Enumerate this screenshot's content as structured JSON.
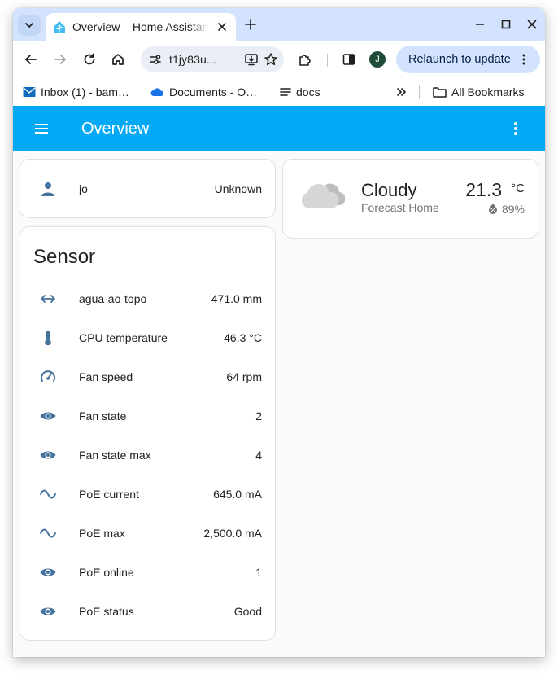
{
  "browser": {
    "tab_title": "Overview – Home Assistant",
    "url": "t1jy83u...",
    "relaunch_label": "Relaunch to update",
    "profile_initial": "J",
    "bookmarks": [
      {
        "label": "Inbox (1) - bam…",
        "icon": "mail-icon"
      },
      {
        "label": "Documents - O…",
        "icon": "onedrive-cloud-icon"
      },
      {
        "label": "docs",
        "icon": "lines-icon"
      }
    ],
    "all_bookmarks_label": "All Bookmarks"
  },
  "app": {
    "title": "Overview",
    "header_color": "#03a9f4"
  },
  "person": {
    "name": "jo",
    "state": "Unknown"
  },
  "weather": {
    "condition": "Cloudy",
    "location": "Forecast Home",
    "temperature": "21.3",
    "unit": "°C",
    "humidity": "89%"
  },
  "sensor_card": {
    "title": "Sensor",
    "rows": [
      {
        "name": "agua-ao-topo",
        "value": "471.0 mm",
        "icon": "arrow-left-right-icon"
      },
      {
        "name": "CPU temperature",
        "value": "46.3 °C",
        "icon": "thermometer-icon"
      },
      {
        "name": "Fan speed",
        "value": "64 rpm",
        "icon": "gauge-icon"
      },
      {
        "name": "Fan state",
        "value": "2",
        "icon": "eye-icon"
      },
      {
        "name": "Fan state max",
        "value": "4",
        "icon": "eye-icon"
      },
      {
        "name": "PoE current",
        "value": "645.0 mA",
        "icon": "sine-wave-icon"
      },
      {
        "name": "PoE max",
        "value": "2,500.0 mA",
        "icon": "sine-wave-icon"
      },
      {
        "name": "PoE online",
        "value": "1",
        "icon": "eye-icon"
      },
      {
        "name": "PoE status",
        "value": "Good",
        "icon": "eye-icon"
      }
    ]
  },
  "colors": {
    "state_icon": "#44739e"
  }
}
